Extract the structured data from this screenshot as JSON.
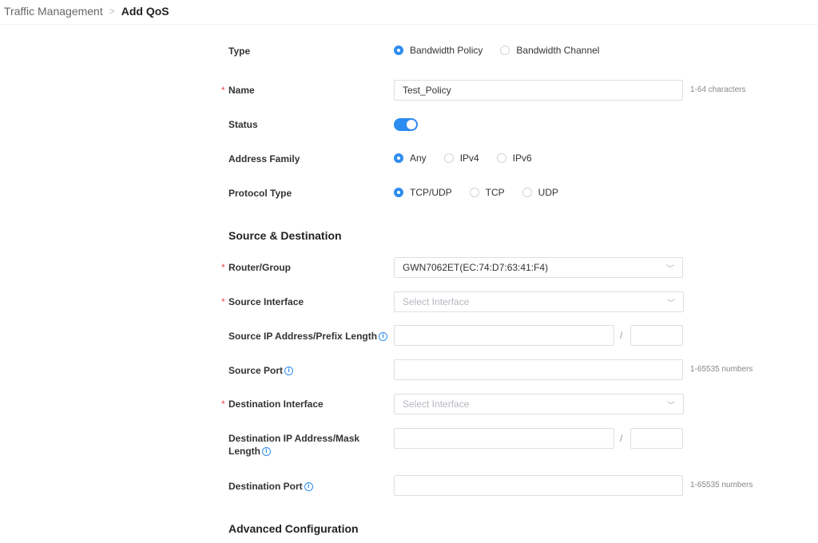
{
  "breadcrumb": {
    "parent": "Traffic Management",
    "current": "Add QoS"
  },
  "form": {
    "type": {
      "label": "Type",
      "options": [
        "Bandwidth Policy",
        "Bandwidth Channel"
      ],
      "selected": "Bandwidth Policy"
    },
    "name": {
      "label": "Name",
      "value": "Test_Policy",
      "hint": "1-64 characters"
    },
    "status": {
      "label": "Status",
      "enabled": true
    },
    "address_family": {
      "label": "Address Family",
      "options": [
        "Any",
        "IPv4",
        "IPv6"
      ],
      "selected": "Any"
    },
    "protocol_type": {
      "label": "Protocol Type",
      "options": [
        "TCP/UDP",
        "TCP",
        "UDP"
      ],
      "selected": "TCP/UDP"
    }
  },
  "source_destination": {
    "title": "Source & Destination",
    "router_group": {
      "label": "Router/Group",
      "value": "GWN7062ET(EC:74:D7:63:41:F4)"
    },
    "source_interface": {
      "label": "Source Interface",
      "placeholder": "Select Interface"
    },
    "source_ip": {
      "label": "Source IP Address/Prefix Length",
      "separator": "/"
    },
    "source_port": {
      "label": "Source Port",
      "hint": "1-65535 numbers"
    },
    "destination_interface": {
      "label": "Destination Interface",
      "placeholder": "Select Interface"
    },
    "destination_ip": {
      "label_line1": "Destination IP Address/Mask",
      "label_line2": "Length",
      "separator": "/"
    },
    "destination_port": {
      "label": "Destination Port",
      "hint": "1-65535 numbers"
    }
  },
  "advanced": {
    "title": "Advanced Configuration"
  },
  "required_mark": "*",
  "icons": {
    "info": "i",
    "chevron": "﹀"
  },
  "colors": {
    "accent": "#2d8cf0",
    "required": "#e5484d"
  }
}
